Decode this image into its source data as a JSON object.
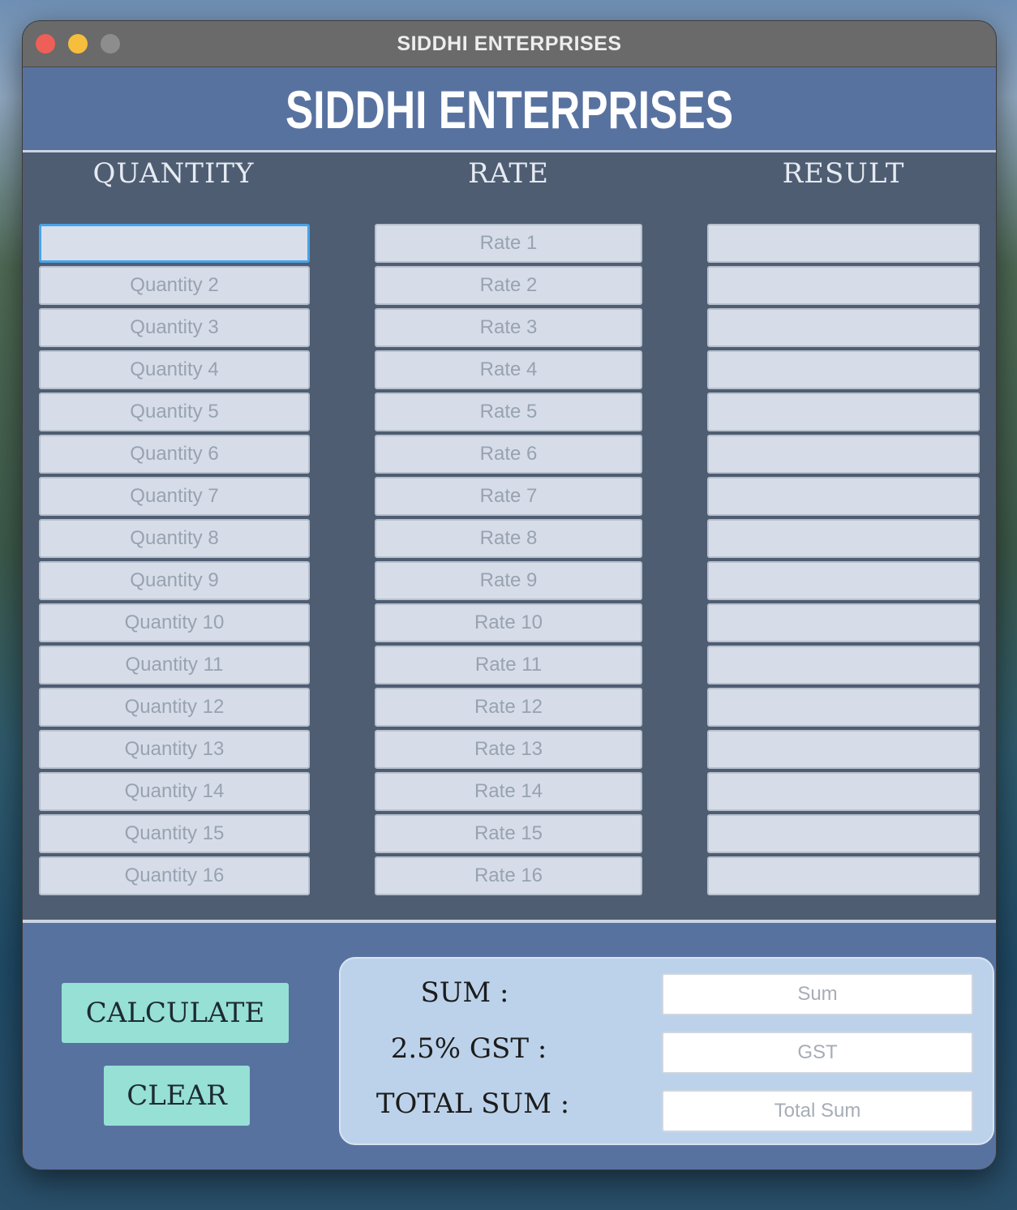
{
  "window": {
    "title": "SIDDHI ENTERPRISES"
  },
  "header": {
    "brand": "SIDDHI ENTERPRISES"
  },
  "columns": {
    "quantity": "QUANTITY",
    "rate": "RATE",
    "result": "RESULT"
  },
  "rows": [
    {
      "quantity_placeholder": "",
      "rate_placeholder": "Rate 1"
    },
    {
      "quantity_placeholder": "Quantity 2",
      "rate_placeholder": "Rate 2"
    },
    {
      "quantity_placeholder": "Quantity 3",
      "rate_placeholder": "Rate 3"
    },
    {
      "quantity_placeholder": "Quantity 4",
      "rate_placeholder": "Rate 4"
    },
    {
      "quantity_placeholder": "Quantity 5",
      "rate_placeholder": "Rate 5"
    },
    {
      "quantity_placeholder": "Quantity 6",
      "rate_placeholder": "Rate 6"
    },
    {
      "quantity_placeholder": "Quantity 7",
      "rate_placeholder": "Rate 7"
    },
    {
      "quantity_placeholder": "Quantity 8",
      "rate_placeholder": "Rate 8"
    },
    {
      "quantity_placeholder": "Quantity 9",
      "rate_placeholder": "Rate 9"
    },
    {
      "quantity_placeholder": "Quantity 10",
      "rate_placeholder": "Rate 10"
    },
    {
      "quantity_placeholder": "Quantity 11",
      "rate_placeholder": "Rate 11"
    },
    {
      "quantity_placeholder": "Quantity 12",
      "rate_placeholder": "Rate 12"
    },
    {
      "quantity_placeholder": "Quantity 13",
      "rate_placeholder": "Rate 13"
    },
    {
      "quantity_placeholder": "Quantity 14",
      "rate_placeholder": "Rate 14"
    },
    {
      "quantity_placeholder": "Quantity 15",
      "rate_placeholder": "Rate 15"
    },
    {
      "quantity_placeholder": "Quantity 16",
      "rate_placeholder": "Rate 16"
    }
  ],
  "buttons": {
    "calculate": "CALCULATE",
    "clear": "CLEAR"
  },
  "summary": {
    "sum_label": "SUM :",
    "gst_label": "2.5% GST :",
    "total_label": "TOTAL SUM :",
    "sum_placeholder": "Sum",
    "gst_placeholder": "GST",
    "total_placeholder": "Total Sum"
  },
  "colors": {
    "header_bg": "#5872a0",
    "body_bg": "#4e5d72",
    "button_bg": "#96e0d6",
    "summary_bg": "#bcd2ea",
    "focus_ring": "#47a3ea"
  }
}
